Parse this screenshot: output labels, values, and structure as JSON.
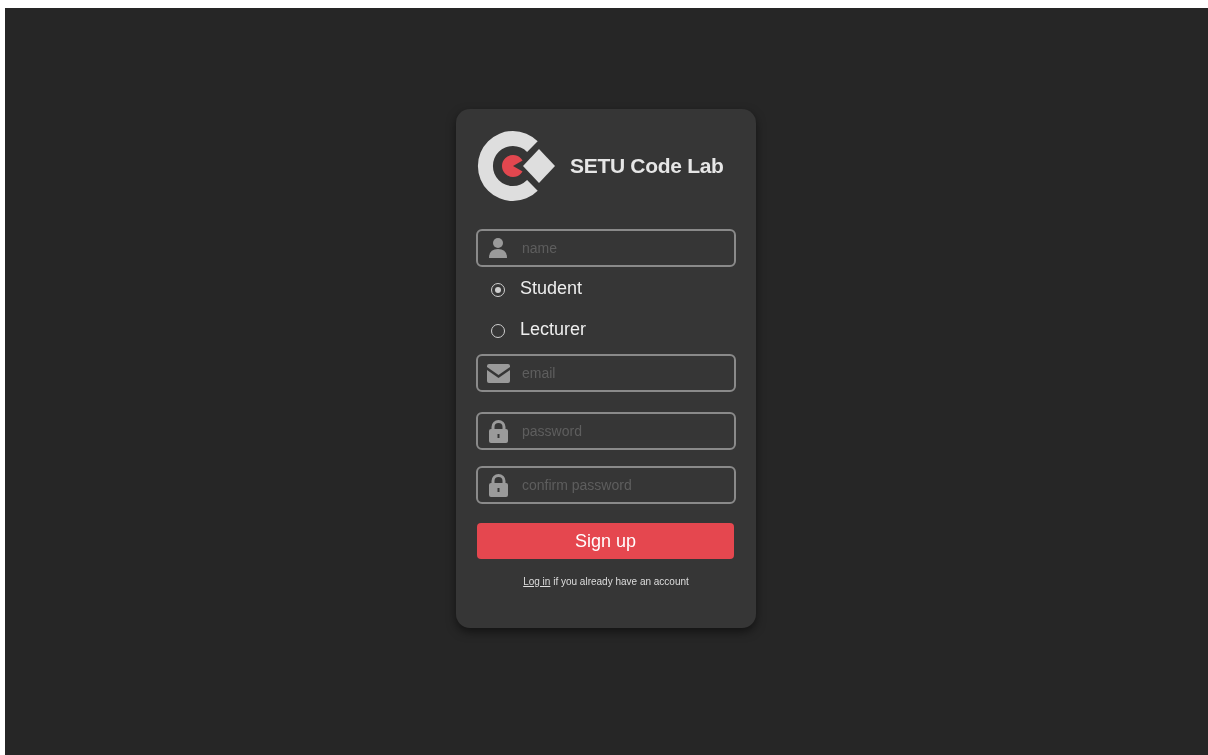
{
  "brand": {
    "title": "SETU Code Lab"
  },
  "name_field": {
    "kind": "person",
    "placeholder": "name"
  },
  "roles": [
    {
      "label": "Student",
      "selected": true
    },
    {
      "label": "Lecturer",
      "selected": false
    }
  ],
  "fields": [
    {
      "kind": "mail",
      "placeholder": "email"
    },
    {
      "kind": "lock",
      "placeholder": "password"
    },
    {
      "kind": "lock",
      "placeholder": "confirm password"
    }
  ],
  "submit": "Sign up",
  "footer": {
    "link": "Log in",
    "text": "if you already have an account"
  }
}
